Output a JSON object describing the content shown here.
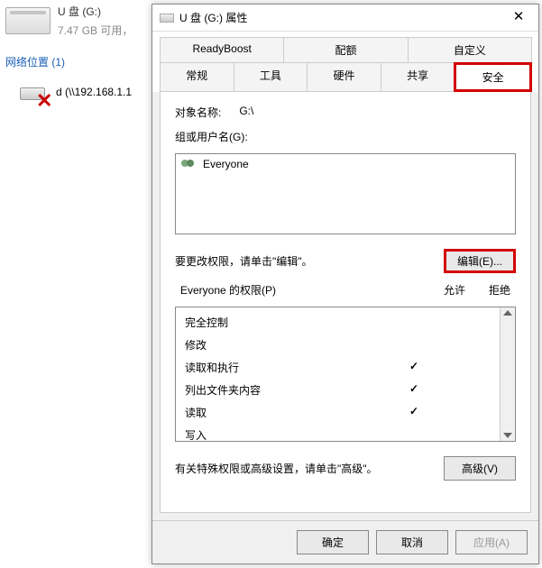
{
  "explorer": {
    "drive_label": "U 盘 (G:)",
    "drive_sub": "7.47 GB 可用，",
    "network_heading": "网络位置 (1)",
    "net_label": "d (\\\\192.168.1.1"
  },
  "dialog": {
    "title": "U 盘 (G:) 属性",
    "tabs_row1": [
      "ReadyBoost",
      "配额",
      "自定义"
    ],
    "tabs_row2": [
      "常规",
      "工具",
      "硬件",
      "共享",
      "安全"
    ],
    "active_tab": "安全",
    "object_label": "对象名称:",
    "object_value": "G:\\",
    "groups_label": "组或用户名(G):",
    "group_item": "Everyone",
    "edit_hint": "要更改权限，请单击\"编辑\"。",
    "edit_btn": "编辑(E)...",
    "perm_title": "Everyone 的权限(P)",
    "allow": "允许",
    "deny": "拒绝",
    "permissions": [
      {
        "name": "完全控制",
        "allow": false,
        "deny": false
      },
      {
        "name": "修改",
        "allow": false,
        "deny": false
      },
      {
        "name": "读取和执行",
        "allow": true,
        "deny": false
      },
      {
        "name": "列出文件夹内容",
        "allow": true,
        "deny": false
      },
      {
        "name": "读取",
        "allow": true,
        "deny": false
      },
      {
        "name": "写入",
        "allow": false,
        "deny": false
      }
    ],
    "adv_hint": "有关特殊权限或高级设置，请单击\"高级\"。",
    "adv_btn": "高级(V)",
    "ok": "确定",
    "cancel": "取消",
    "apply": "应用(A)"
  }
}
